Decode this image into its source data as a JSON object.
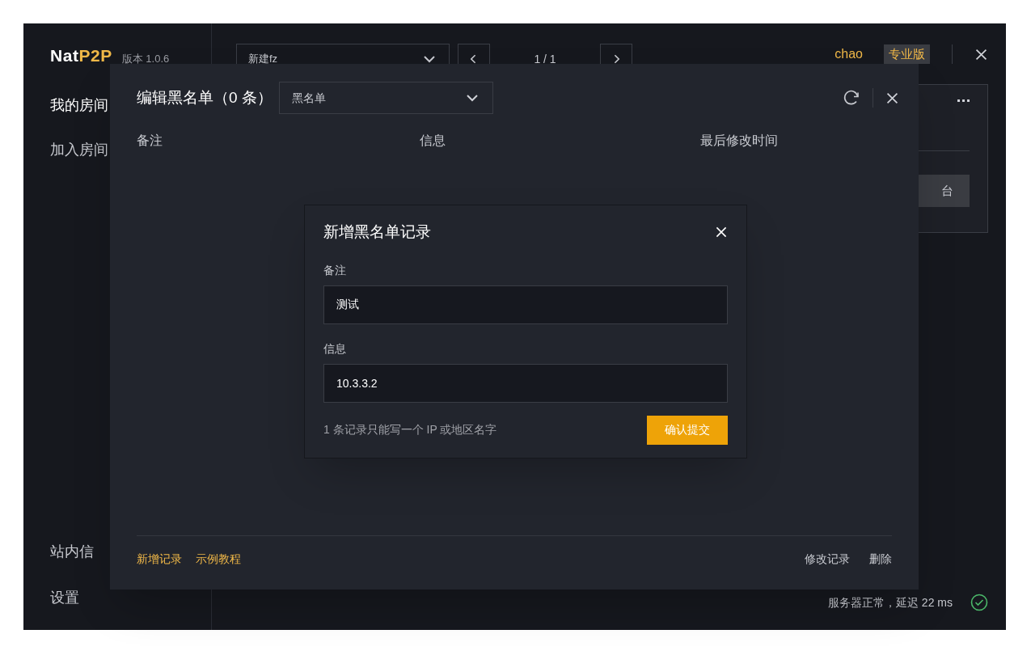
{
  "app": {
    "logo_main": "Nat",
    "logo_accent": "P2P",
    "version": "版本 1.0.6"
  },
  "sidebar": {
    "items": [
      {
        "label": "我的房间",
        "selected": true
      },
      {
        "label": "加入房间",
        "selected": false
      }
    ],
    "bottom_items": [
      "站内信",
      "设置"
    ]
  },
  "toolbar": {
    "room_select": "新建fz",
    "page": "1 / 1",
    "user": "chao",
    "plan_badge": "专业版"
  },
  "room_card": {
    "button": "台"
  },
  "status_bar": {
    "text": "服务器正常，延迟 22 ms",
    "ok": true
  },
  "blacklist_dialog": {
    "title": "编辑黑名单（0 条）",
    "list_select": "黑名单",
    "columns": [
      "备注",
      "信息",
      "最后修改时间"
    ],
    "footer_left": [
      "新增记录",
      "示例教程"
    ],
    "footer_right": [
      "修改记录",
      "删除"
    ]
  },
  "add_dialog": {
    "title": "新增黑名单记录",
    "fields": [
      {
        "label": "备注",
        "value": "测试"
      },
      {
        "label": "信息",
        "value": "10.3.3.2"
      }
    ],
    "hint": "1 条记录只能写一个 IP 或地区名字",
    "submit": "确认提交"
  }
}
